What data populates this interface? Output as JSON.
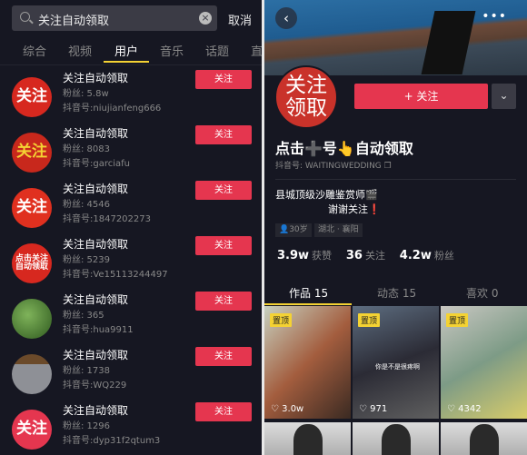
{
  "search": {
    "query": "关注自动领取",
    "cancel": "取消"
  },
  "tabs": [
    "综合",
    "视频",
    "用户",
    "音乐",
    "话题",
    "直"
  ],
  "follow_label": "关注",
  "users": [
    {
      "name": "关注自动领取",
      "fans": "粉丝: 5.8w",
      "id": "抖音号:niujianfeng666",
      "avatar": "关注",
      "color": "#d7281f",
      "text_color": "#fff"
    },
    {
      "name": "关注自动领取",
      "fans": "粉丝: 8083",
      "id": "抖音号:garciafu",
      "avatar": "关注",
      "color": "#c8281c",
      "text_color": "#f4d233"
    },
    {
      "name": "关注自动领取",
      "fans": "粉丝: 4546",
      "id": "抖音号:1847202273",
      "avatar": "关注",
      "color": "#e0301f",
      "text_color": "#fff"
    },
    {
      "name": "关注自动领取",
      "fans": "粉丝: 5239",
      "id": "抖音号:Ve15113244497",
      "avatar": "点击关注自动领取",
      "color": "#d7281f",
      "text_color": "#fff"
    },
    {
      "name": "关注自动领取",
      "fans": "粉丝: 365",
      "id": "抖音号:hua9911",
      "avatar": "",
      "color": "#4a7a30",
      "text_color": "#fff"
    },
    {
      "name": "关注自动领取",
      "fans": "粉丝: 1738",
      "id": "抖音号:WQ229",
      "avatar": "",
      "color": "#8a8a8a",
      "text_color": "#fff"
    },
    {
      "name": "关注自动领取",
      "fans": "粉丝: 1296",
      "id": "抖音号:dyp31f2qtum3",
      "avatar": "关注",
      "color": "#e5364f",
      "text_color": "#fff"
    }
  ],
  "profile": {
    "avatar": "关注领取",
    "follow": "+ 关注",
    "title": "点击➕号👆自动领取",
    "douyin_id": "抖音号: WAITINGWEDDING",
    "bio1": "县城顶级沙雕鉴赏师🎬",
    "bio2": "谢谢关注❗",
    "tags": [
      "👤30岁",
      "湖北 · 襄阳"
    ],
    "stats": [
      {
        "n": "3.9w",
        "l": "获赞"
      },
      {
        "n": "36",
        "l": "关注"
      },
      {
        "n": "4.2w",
        "l": "粉丝"
      }
    ],
    "tabs": [
      "作品 15",
      "动态 15",
      "喜欢 0"
    ],
    "pinned_label": "置顶",
    "videos": [
      {
        "likes": "3.0w",
        "caption": ""
      },
      {
        "likes": "971",
        "caption": "你是不是很疼啊"
      },
      {
        "likes": "4342",
        "caption": ""
      }
    ]
  },
  "colors": {
    "accent": "#e5364f",
    "tab_underline": "#f4d233",
    "bg": "#161722"
  }
}
